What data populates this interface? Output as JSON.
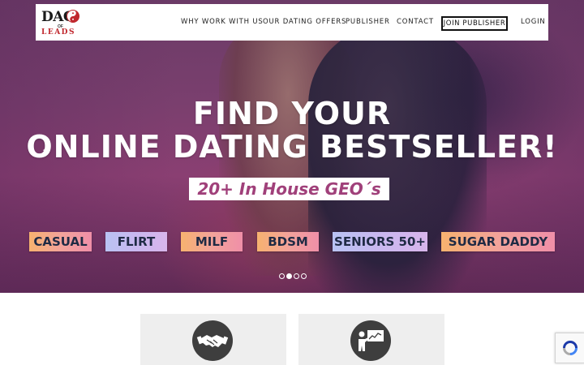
{
  "logo": {
    "word_top": "DAO",
    "word_of": "OF",
    "word_bottom": "LEADS"
  },
  "nav": {
    "items": [
      "WHY WORK WITH US",
      "OUR DATING OFFERS",
      "PUBLISHER",
      "CONTACT"
    ],
    "join_label": "JOIN PUBLISHER",
    "login_label": "LOGIN"
  },
  "hero": {
    "headline_line1": "FIND YOUR",
    "headline_line2": "ONLINE DATING BESTSELLER!",
    "geo_badge": "20+ In House GEO´s",
    "prev_arrow": "‹",
    "next_arrow": "›",
    "categories": [
      "CASUAL",
      "FLIRT",
      "MILF",
      "BDSM",
      "SENIORS 50+",
      "SUGAR DADDY"
    ],
    "slider": {
      "total_slides": 4,
      "active_index": 1
    }
  },
  "cards": [
    {
      "icon": "handshake-icon"
    },
    {
      "icon": "presentation-chart-icon"
    }
  ],
  "colors": {
    "accent_red": "#c0272d",
    "badge_text": "#a0407a",
    "category_text": "#1f2a44",
    "card_bg": "#eeeeee",
    "icon_circle": "#3e3e3e"
  }
}
